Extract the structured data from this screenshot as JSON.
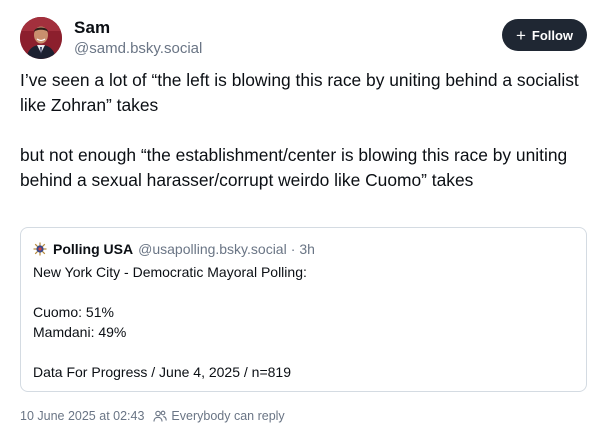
{
  "author": {
    "display_name": "Sam",
    "handle": "@samd.bsky.social"
  },
  "follow_button": {
    "icon": "plus-icon",
    "label": "Follow"
  },
  "post": {
    "paragraphs": [
      "I’ve seen a lot of “the left is blowing this race by uniting behind a socialist like Zohran” takes",
      "but not enough “the establishment/center is blowing this race by uniting behind a sexual harasser/corrupt weirdo like Cuomo” takes"
    ]
  },
  "quote": {
    "author": "Polling USA",
    "handle": "@usapolling.bsky.social",
    "separator": "·",
    "time": "3h",
    "lines": [
      "New York City - Democratic Mayoral Polling:",
      "",
      "Cuomo: 51%",
      "Mamdani: 49%",
      "",
      "Data For Progress / June 4, 2025 / n=819"
    ]
  },
  "meta": {
    "timestamp": "10 June 2025 at 02:43",
    "reply_setting": "Everybody can reply",
    "reply_icon": "users-icon"
  },
  "colors": {
    "follow_button_bg": "#1f2733",
    "muted_text": "#6a7585",
    "border": "#d4dbe2"
  }
}
